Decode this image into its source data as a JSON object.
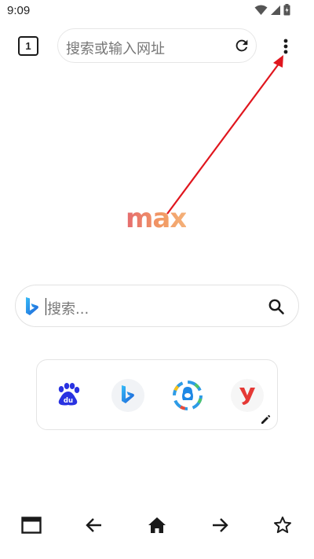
{
  "status_bar": {
    "time": "9:09",
    "icons": [
      "wifi-icon",
      "signal-icon",
      "battery-icon"
    ]
  },
  "top_bar": {
    "tab_count": "1",
    "address_placeholder": "搜索或输入网址",
    "reload_icon": "reload-icon",
    "menu_icon": "more-vert-icon"
  },
  "logo": {
    "text": "max",
    "colors": [
      "#e56b6f",
      "#f4b179"
    ]
  },
  "search": {
    "engine_icon": "bing-icon",
    "placeholder": "搜索...",
    "button_icon": "search-icon"
  },
  "shortcuts": {
    "items": [
      {
        "icon": "baidu-icon",
        "color": "#2932e1"
      },
      {
        "icon": "bing-icon",
        "color": "#0c8ce9"
      },
      {
        "icon": "qq-icon",
        "color": "#1e88e5"
      },
      {
        "icon": "youku-icon",
        "color": "#e53935"
      }
    ],
    "edit_icon": "pencil-icon"
  },
  "bottom_nav": {
    "items": [
      "tabs-icon",
      "back-icon",
      "home-icon",
      "forward-icon",
      "star-icon"
    ]
  },
  "annotation": {
    "arrow_color": "#e0161e"
  }
}
